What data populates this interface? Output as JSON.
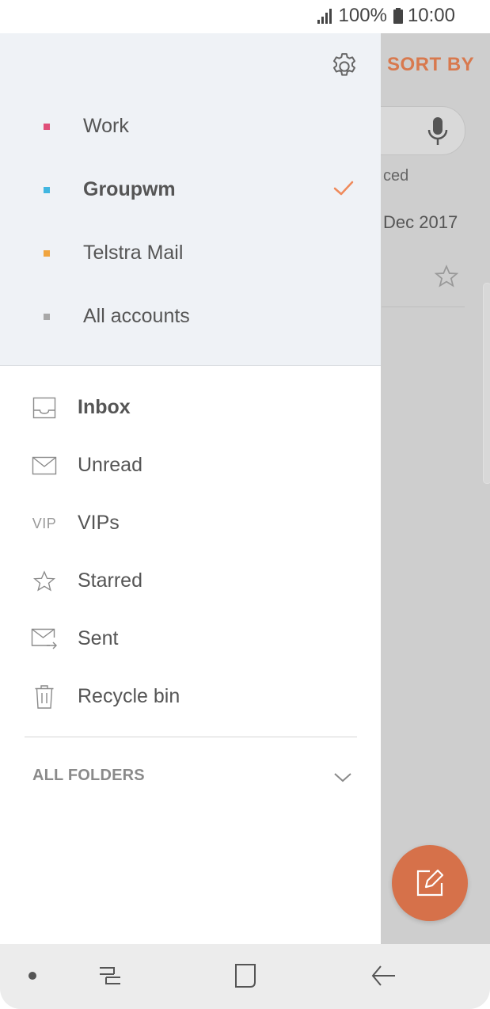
{
  "status_bar": {
    "battery": "100%",
    "time": "10:00",
    "icons": [
      "signal-icon",
      "battery-icon"
    ]
  },
  "background": {
    "sort_by": "SORT BY",
    "snippet": "ced",
    "date": "Dec 2017"
  },
  "accounts": [
    {
      "label": "Work",
      "color": "#e0507a",
      "selected": false
    },
    {
      "label": "Groupwm",
      "color": "#41b6e0",
      "selected": true
    },
    {
      "label": "Telstra Mail",
      "color": "#f0a540",
      "selected": false
    },
    {
      "label": "All accounts",
      "color": "#a8a8a8",
      "selected": false
    }
  ],
  "folders": [
    {
      "label": "Inbox",
      "icon": "inbox-icon",
      "bold": true
    },
    {
      "label": "Unread",
      "icon": "envelope-icon",
      "bold": false
    },
    {
      "label": "VIPs",
      "icon": "vip-icon",
      "icon_text": "VIP",
      "bold": false
    },
    {
      "label": "Starred",
      "icon": "star-icon",
      "bold": false
    },
    {
      "label": "Sent",
      "icon": "sent-icon",
      "bold": false
    },
    {
      "label": "Recycle bin",
      "icon": "trash-icon",
      "bold": false
    }
  ],
  "all_folders_label": "ALL FOLDERS",
  "colors": {
    "accent": "#d6714a",
    "check": "#ef8a5b"
  }
}
